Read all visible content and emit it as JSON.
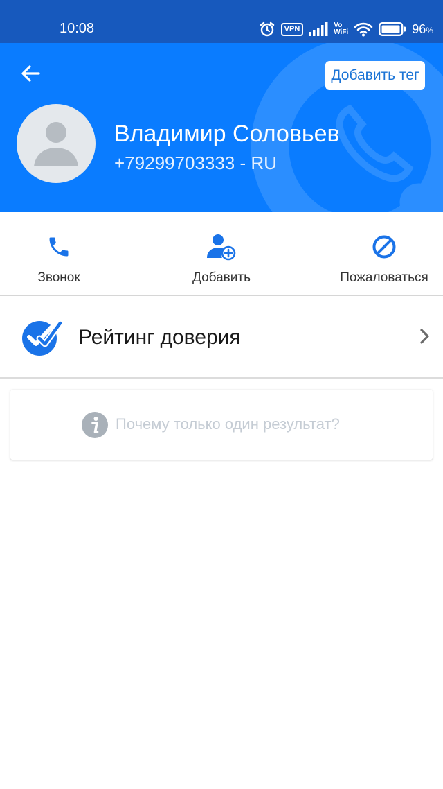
{
  "status_bar": {
    "time": "10:08",
    "vpn": "VPN",
    "vo": "Vo",
    "wifi": "WiFi",
    "battery": "96",
    "battery_unit": "%",
    "icons": [
      "alarm-icon",
      "signal-icon",
      "wifi-icon",
      "battery-icon"
    ]
  },
  "header": {
    "add_tag": "Добавить тег",
    "name": "Владимир Соловьев",
    "phone": "+79299703333 - RU",
    "icons": [
      "back-arrow-icon",
      "avatar-placeholder-icon"
    ],
    "colors": {
      "background": "#0a7cff",
      "status_bar": "#1759bd"
    }
  },
  "actions": [
    {
      "label": "Звонок",
      "icon": "phone-icon"
    },
    {
      "label": "Добавить",
      "icon": "add-contact-icon"
    },
    {
      "label": "Пожаловаться",
      "icon": "block-icon"
    }
  ],
  "rating": {
    "label": "Рейтинг доверия",
    "icon": "check-badge-icon",
    "chevron": "chevron-right-icon"
  },
  "info": {
    "text": "Почему только один результат?",
    "icon": "info-icon"
  },
  "colors": {
    "accent": "#1a73e8",
    "info_text": "#c5ccd4"
  }
}
